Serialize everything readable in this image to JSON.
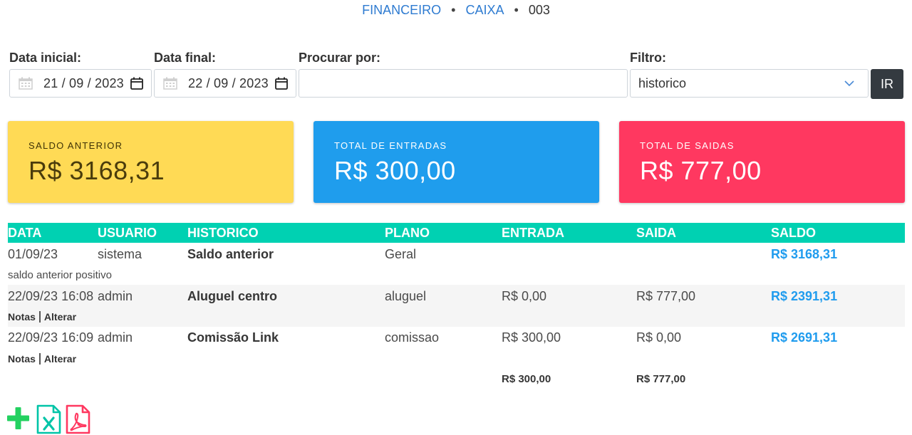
{
  "breadcrumb": {
    "item1": "FINANCEIRO",
    "item2": "CAIXA",
    "current": "003",
    "separator": "•"
  },
  "filters": {
    "data_inicial_label": "Data inicial:",
    "data_inicial_value": "21 / 09 / 2023",
    "data_final_label": "Data final:",
    "data_final_value": "22 / 09 / 2023",
    "procurar_label": "Procurar por:",
    "procurar_value": "",
    "filtro_label": "Filtro:",
    "filtro_value": "historico",
    "ir_button": "IR"
  },
  "cards": [
    {
      "label": "SALDO ANTERIOR",
      "value": "R$ 3168,31",
      "color": "#ffda55"
    },
    {
      "label": "TOTAL DE ENTRADAS",
      "value": "R$ 300,00",
      "color": "#1f9ded"
    },
    {
      "label": "TOTAL DE SAIDAS",
      "value": "R$ 777,00",
      "color": "#ff3860"
    }
  ],
  "table": {
    "columns": [
      "DATA",
      "USUARIO",
      "HISTORICO",
      "PLANO",
      "ENTRADA",
      "SAIDA",
      "SALDO"
    ],
    "rows": [
      {
        "data": "01/09/23",
        "usuario": "sistema",
        "historico": "Saldo anterior",
        "plano": "Geral",
        "entrada": "",
        "saida": "",
        "saldo": "R$ 3168,31",
        "note": "saldo anterior positivo"
      },
      {
        "data": "22/09/23 16:08",
        "usuario": "admin",
        "historico": "Aluguel centro",
        "plano": "aluguel",
        "entrada": "R$ 0,00",
        "saida": "R$ 777,00",
        "saldo": "R$ 2391,31",
        "actions": [
          "Notas",
          "Alterar"
        ]
      },
      {
        "data": "22/09/23 16:09",
        "usuario": "admin",
        "historico": "Comissão Link",
        "plano": "comissao",
        "entrada": "R$ 300,00",
        "saida": "R$ 0,00",
        "saldo": "R$ 2691,31",
        "actions": [
          "Notas",
          "Alterar"
        ]
      }
    ],
    "totals": {
      "entrada": "R$ 300,00",
      "saida": "R$ 777,00"
    }
  },
  "toolbar": {
    "icons": [
      "plus-icon",
      "excel-icon",
      "pdf-icon"
    ]
  },
  "colors": {
    "accent": "#2e7bd1",
    "header_teal": "#00d1b2",
    "saldo_blue": "#209cee",
    "plus_green": "#23d160",
    "excel_teal": "#00c4a7",
    "pdf_red": "#ff3860"
  }
}
